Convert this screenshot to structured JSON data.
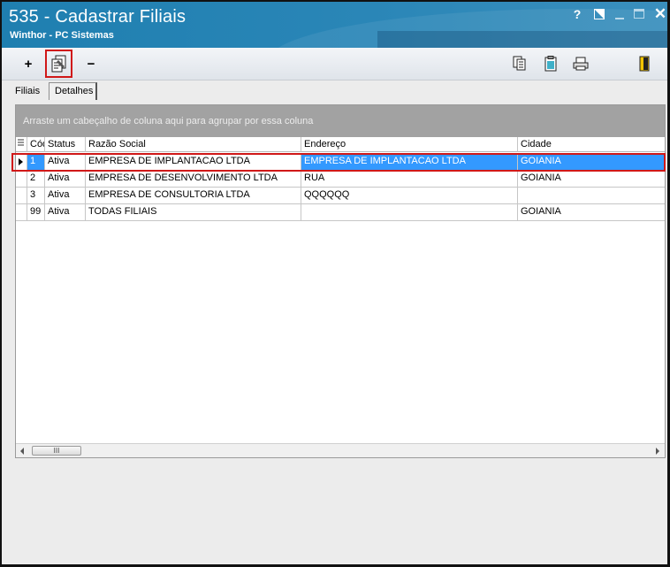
{
  "window": {
    "title": "535 - Cadastrar Filiais",
    "subtitle": "Winthor - PC Sistemas",
    "help_glyph": "?",
    "close_glyph": "✕"
  },
  "toolbar": {
    "left": [
      {
        "name": "add-icon",
        "glyph": "+"
      },
      {
        "name": "edit-document-icon"
      },
      {
        "name": "remove-icon",
        "glyph": "−"
      }
    ],
    "right": [
      {
        "name": "copy-icon"
      },
      {
        "name": "clipboard-icon"
      },
      {
        "name": "printer-icon"
      },
      {
        "name": "exit-door-icon"
      }
    ],
    "highlight_color": "#d01818"
  },
  "tabs": [
    {
      "label": "Filiais",
      "active": true
    },
    {
      "label": "Detalhes",
      "active": false
    }
  ],
  "grid": {
    "group_hint": "Arraste um cabeçalho de coluna aqui para agrupar por essa coluna",
    "columns": [
      "Código",
      "Status",
      "Razão Social",
      "Endereço",
      "Cidade"
    ],
    "rows": [
      {
        "codigo": "1",
        "status": "Ativa",
        "razao": "EMPRESA DE IMPLANTACAO LTDA",
        "endereco": "EMPRESA DE IMPLANTACAO LTDA",
        "cidade": "GOIANIA"
      },
      {
        "codigo": "2",
        "status": "Ativa",
        "razao": "EMPRESA DE DESENVOLVIMENTO LTDA",
        "endereco": "RUA",
        "cidade": "GOIANIA"
      },
      {
        "codigo": "3",
        "status": "Ativa",
        "razao": "EMPRESA DE CONSULTORIA LTDA",
        "endereco": "QQQQQQ",
        "cidade": ""
      },
      {
        "codigo": "99",
        "status": "Ativa",
        "razao": "TODAS FILIAIS",
        "endereco": "",
        "cidade": "GOIANIA"
      }
    ],
    "selected_row": 0,
    "selection_color": "#3399ff",
    "scroll_thumb_glyph": "III"
  }
}
